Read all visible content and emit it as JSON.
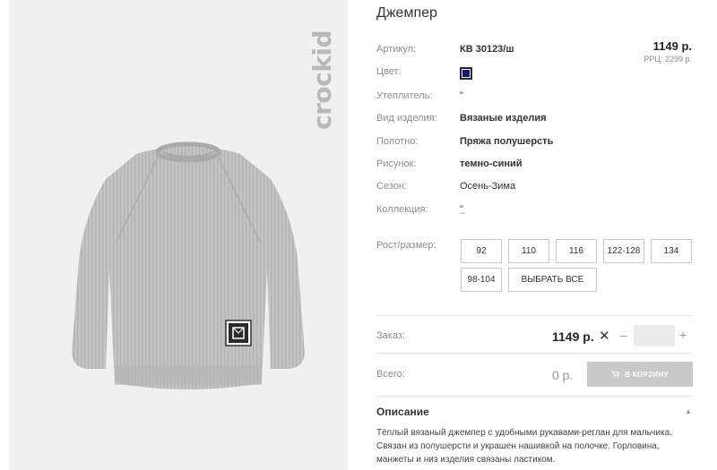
{
  "product": {
    "title": "Джемпер",
    "brand": "crockid",
    "price": "1149 р.",
    "rrp": "РРЦ: 2299 р."
  },
  "specs": [
    {
      "label": "Артикул:",
      "value": "КВ 30123/ш"
    },
    {
      "label": "Цвет:",
      "value": ""
    },
    {
      "label": "Утеплитель:",
      "value": "\""
    },
    {
      "label": "Вид изделия:",
      "value": "Вязаные изделия"
    },
    {
      "label": "Полотно:",
      "value": "Пряжа полушерсть"
    },
    {
      "label": "Рисунок:",
      "value": "темно-синий"
    },
    {
      "label": "Сезон:",
      "value": "Осень-Зима"
    },
    {
      "label": "Коллекция:",
      "value": "\""
    }
  ],
  "colors": {
    "swatch": "#1b1464",
    "cart_button": "#c9c9c9"
  },
  "sizes": {
    "label": "Рост/размер:",
    "options": [
      "92",
      "110",
      "116",
      "122-128",
      "134",
      "98-104"
    ],
    "select_all": "ВЫБРАТЬ ВСЕ"
  },
  "order": {
    "label": "Заказ:",
    "price": "1149 р.",
    "times": "✕",
    "minus": "–",
    "plus": "+",
    "quantity": ""
  },
  "total": {
    "label": "Всего:",
    "value": "0 р.",
    "cart_button": "В КОРЗИНУ",
    "cart_icon": "cart-icon"
  },
  "description": {
    "header": "Описание",
    "text": "Тёплый вязаный джемпер с удобными рукавами-реглан для мальчика. Связан из полушерсти и украшен нашивкой на полочке. Горловина, манжеты и низ изделия связаны ластиком."
  }
}
